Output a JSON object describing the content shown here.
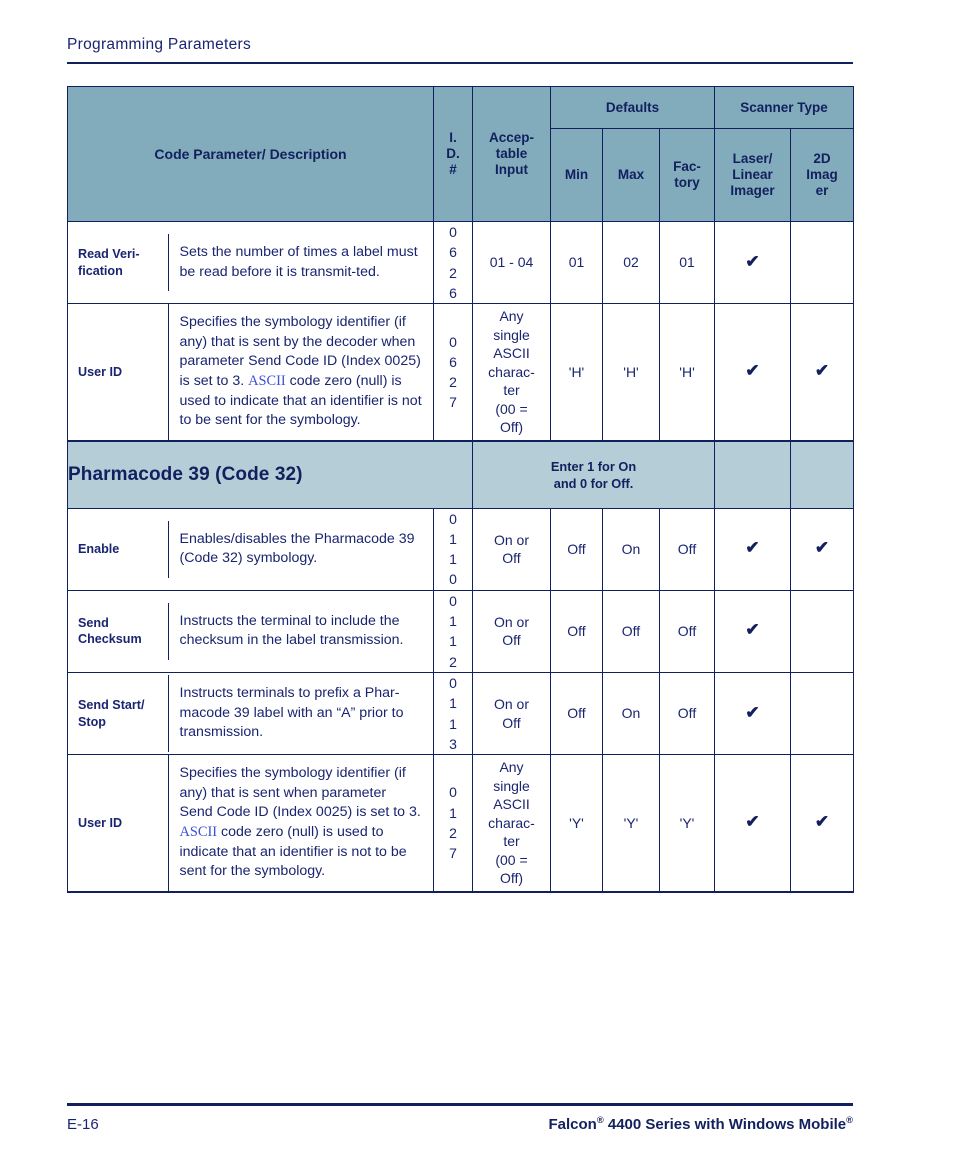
{
  "page": {
    "running_head": "Programming Parameters",
    "footer_left": "E-16",
    "footer_right_pre": "Falcon",
    "footer_right_mid": " 4400 Series with Windows Mobile",
    "footer_reg_mark": "®"
  },
  "colors": {
    "header_bg": "#82abbc",
    "section_bg": "#b4cdd6",
    "rule": "#12205e",
    "text": "#1a2570",
    "xref": "#3b50d8"
  },
  "table": {
    "headers": {
      "code_parameter": "Code Parameter/ Description",
      "id": "I. D. #",
      "id_line1": "I.",
      "id_line2": "D.",
      "id_line3": "#",
      "acceptable_input_line1": "Accep-",
      "acceptable_input_line2": "table",
      "acceptable_input_line3": "Input",
      "defaults": "Defaults",
      "scanner_type": "Scanner Type",
      "min": "Min",
      "max": "Max",
      "factory_line1": "Fac-",
      "factory_line2": "tory",
      "laser_line1": "Laser/",
      "laser_line2": "Linear",
      "laser_line3": "Imager",
      "imager2d_line1": "2D",
      "imager2d_line2": "Imag",
      "imager2d_line3": "er"
    },
    "check_glyph": "✔",
    "rows": [
      {
        "name": "Read Veri-\nfication",
        "description": "Sets the number of times a label must be read before it is transmit-ted.",
        "desc_pre": "Sets the number of times a label must be read before it is transmit-ted.",
        "desc_xref": "",
        "desc_post": "",
        "id": "0\n6\n2\n6",
        "acceptable_input": "01 - 04",
        "min": "01",
        "max": "02",
        "factory": "01",
        "laser": true,
        "imager2d": false
      },
      {
        "name": "User ID",
        "desc_pre": "Specifies the symbology identifier (if any) that is sent by the decoder when parameter Send Code ID (Index 0025) is set to 3. ",
        "desc_xref": "ASCII",
        "desc_post": " code zero (null) is used to indicate that an identifier is not to be sent for the symbology.",
        "id": "0\n6\n2\n7",
        "acceptable_input": "Any\nsingle\nASCII\ncharac-\nter\n(00 =\nOff)",
        "min": "'H'",
        "max": "'H'",
        "factory": "'H'",
        "laser": true,
        "imager2d": true
      }
    ],
    "section": {
      "title": "Pharmacode 39 (Code 32)",
      "note_line1": "Enter 1 for On",
      "note_line2": "and 0 for Off."
    },
    "section_rows": [
      {
        "name": "Enable",
        "desc_pre": "Enables/disables the Pharmacode 39 (Code 32) symbology.",
        "desc_xref": "",
        "desc_post": "",
        "id": "0\n1\n1\n0",
        "acceptable_input": "On or\nOff",
        "min": "Off",
        "max": "On",
        "factory": "Off",
        "laser": true,
        "imager2d": true
      },
      {
        "name": "Send\nChecksum",
        "desc_pre": "Instructs the terminal to include the checksum in the label transmission.",
        "desc_xref": "",
        "desc_post": "",
        "id": "0\n1\n1\n2",
        "acceptable_input": "On or\nOff",
        "min": "Off",
        "max": "Off",
        "factory": "Off",
        "laser": true,
        "imager2d": false
      },
      {
        "name": "Send Start/\nStop",
        "desc_pre": "Instructs terminals to prefix a Phar-macode 39 label with an “A” prior to transmission.",
        "desc_xref": "",
        "desc_post": "",
        "id": "0\n1\n1\n3",
        "acceptable_input": "On or\nOff",
        "min": "Off",
        "max": "On",
        "factory": "Off",
        "laser": true,
        "imager2d": false
      },
      {
        "name": "User ID",
        "desc_pre": "Specifies the symbology identifier (if any) that is sent when parameter Send Code ID (Index 0025) is set to 3. ",
        "desc_xref": "ASCII",
        "desc_post": " code zero (null) is used to indicate that an identifier is not to be sent for the symbology.",
        "id": "0\n1\n2\n7",
        "acceptable_input": "Any\nsingle\nASCII\ncharac-\nter\n(00 =\nOff)",
        "min": "'Y'",
        "max": "'Y'",
        "factory": "'Y'",
        "laser": true,
        "imager2d": true
      }
    ]
  }
}
